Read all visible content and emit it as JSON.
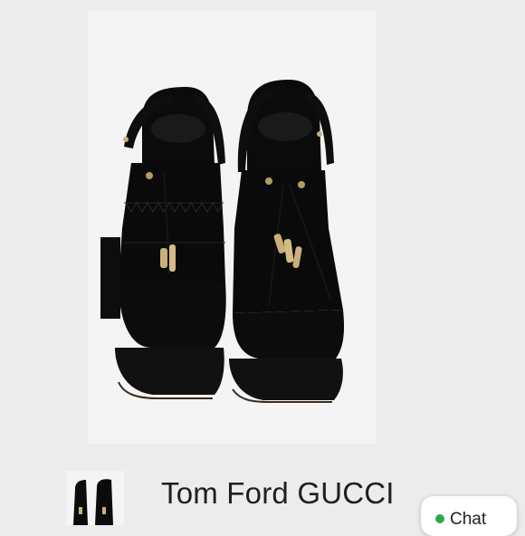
{
  "listing": {
    "title": "Tom Ford GUCCI",
    "main_image_icon": "black-suede-fringe-sandals-photo",
    "thumbnail_icon": "sandals-thumbnail"
  },
  "chat": {
    "label": "Chat",
    "status_color": "#2ea84e"
  }
}
